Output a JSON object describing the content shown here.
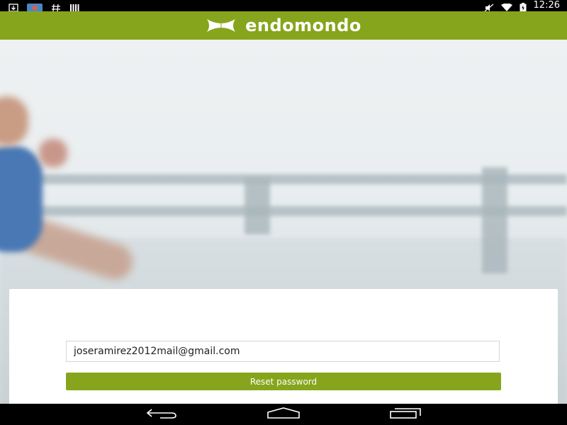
{
  "status_bar": {
    "time": "12:26",
    "left_icons": [
      "download-icon",
      "photos-icon",
      "hash-icon",
      "barcode-icon"
    ],
    "right_icons": [
      "mute-icon",
      "wifi-icon",
      "battery-icon"
    ]
  },
  "header": {
    "brand_name": "endomondo",
    "logo_icon": "under-armour-logo",
    "background_color": "#86a51c"
  },
  "form": {
    "email_value": "joseramirez2012mail@gmail.com",
    "reset_button_label": "Reset password",
    "accent_color": "#86a51c"
  },
  "nav_bar": {
    "buttons": [
      "back-icon",
      "home-icon",
      "recents-icon"
    ]
  }
}
